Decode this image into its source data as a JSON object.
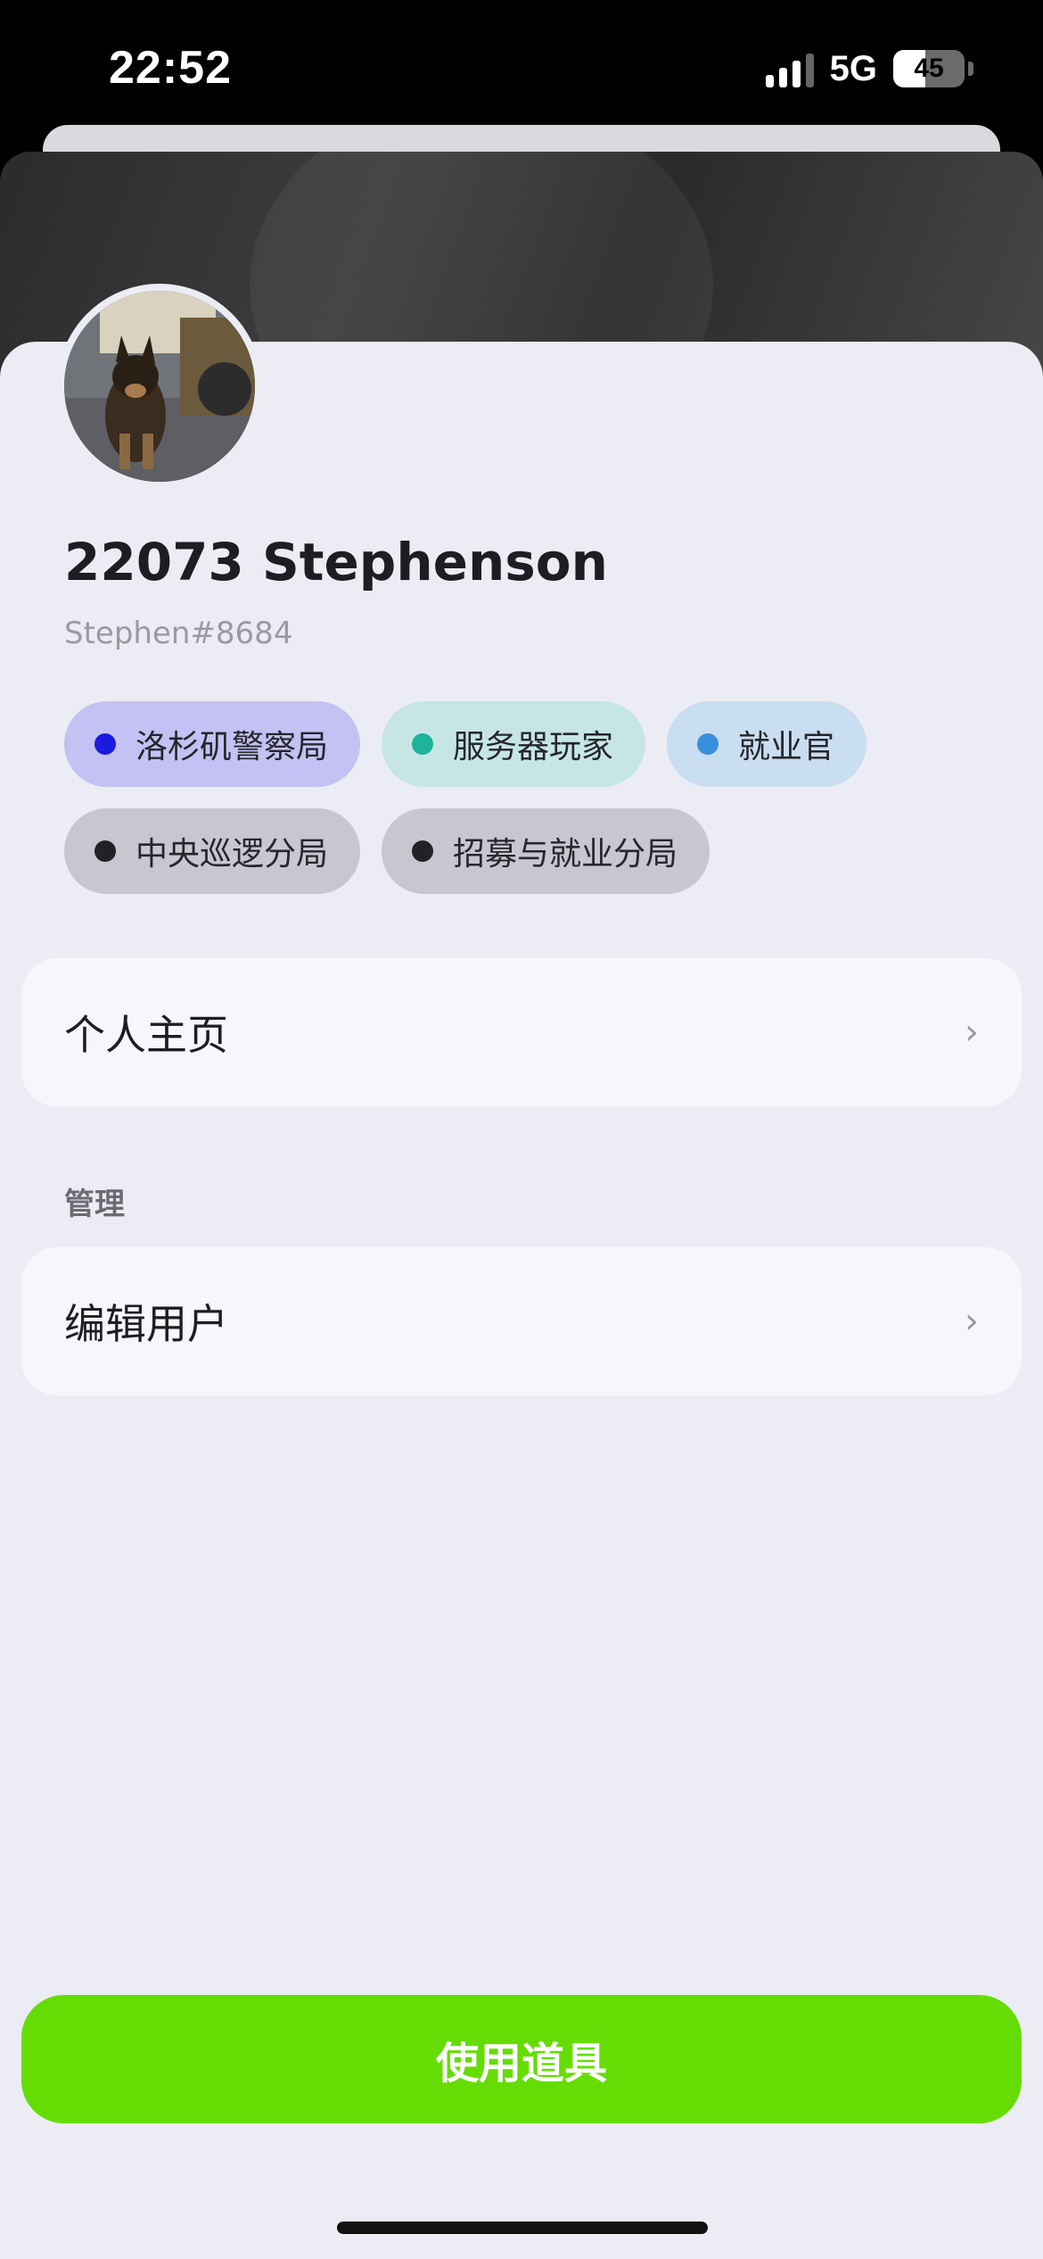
{
  "status_bar": {
    "time": "22:52",
    "network": "5G",
    "battery": "45"
  },
  "profile": {
    "name": "22073 Stephenson",
    "handle": "Stephen#8684"
  },
  "tags": [
    {
      "label": "洛杉矶警察局",
      "dot_color": "#1b1be0",
      "bg_color": "#c4c1f3"
    },
    {
      "label": "服务器玩家",
      "dot_color": "#1fb39a",
      "bg_color": "#c6e6e6"
    },
    {
      "label": "就业官",
      "dot_color": "#3a8fdc",
      "bg_color": "#c9def0"
    },
    {
      "label": "中央巡逻分局",
      "dot_color": "#222226",
      "bg_color": "#c7c7cf"
    },
    {
      "label": "招募与就业分局",
      "dot_color": "#222226",
      "bg_color": "#c7c7cf"
    }
  ],
  "menu": {
    "profile_page": "个人主页",
    "section_manage": "管理",
    "edit_user": "编辑用户",
    "chevron": "›"
  },
  "actions": {
    "use_item": "使用道具"
  },
  "colors": {
    "accent_green": "#65dd04",
    "sheet_bg": "#ececf4",
    "card_bg": "#f6f6fb"
  }
}
